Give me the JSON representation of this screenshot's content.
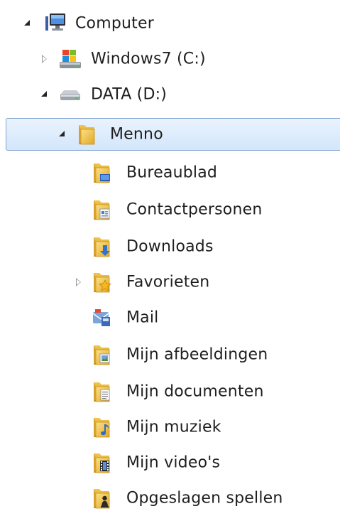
{
  "tree": {
    "computer": {
      "label": "Computer",
      "icon": "computer-icon",
      "state": "expanded"
    },
    "drive_c": {
      "label": "Windows7 (C:)",
      "icon": "windows-drive-icon",
      "state": "collapsed"
    },
    "drive_d": {
      "label": "DATA (D:)",
      "icon": "hard-drive-icon",
      "state": "expanded"
    },
    "menno": {
      "label": "Menno",
      "icon": "folder-icon",
      "state": "expanded",
      "selected": true
    },
    "children": [
      {
        "label": "Bureaublad",
        "icon": "desktop-folder-icon"
      },
      {
        "label": "Contactpersonen",
        "icon": "contacts-folder-icon"
      },
      {
        "label": "Downloads",
        "icon": "downloads-folder-icon"
      },
      {
        "label": "Favorieten",
        "icon": "favorites-folder-icon",
        "state": "collapsed"
      },
      {
        "label": "Mail",
        "icon": "mail-icon"
      },
      {
        "label": "Mijn afbeeldingen",
        "icon": "pictures-folder-icon"
      },
      {
        "label": "Mijn documenten",
        "icon": "documents-folder-icon"
      },
      {
        "label": "Mijn muziek",
        "icon": "music-folder-icon"
      },
      {
        "label": "Mijn video's",
        "icon": "videos-folder-icon"
      },
      {
        "label": "Opgeslagen spellen",
        "icon": "saved-games-folder-icon"
      }
    ]
  },
  "colors": {
    "selection_border": "#7da2ce",
    "selection_fill": "#d3e6fb",
    "folder_yellow": "#f3c843",
    "text": "#1e1e1e"
  }
}
